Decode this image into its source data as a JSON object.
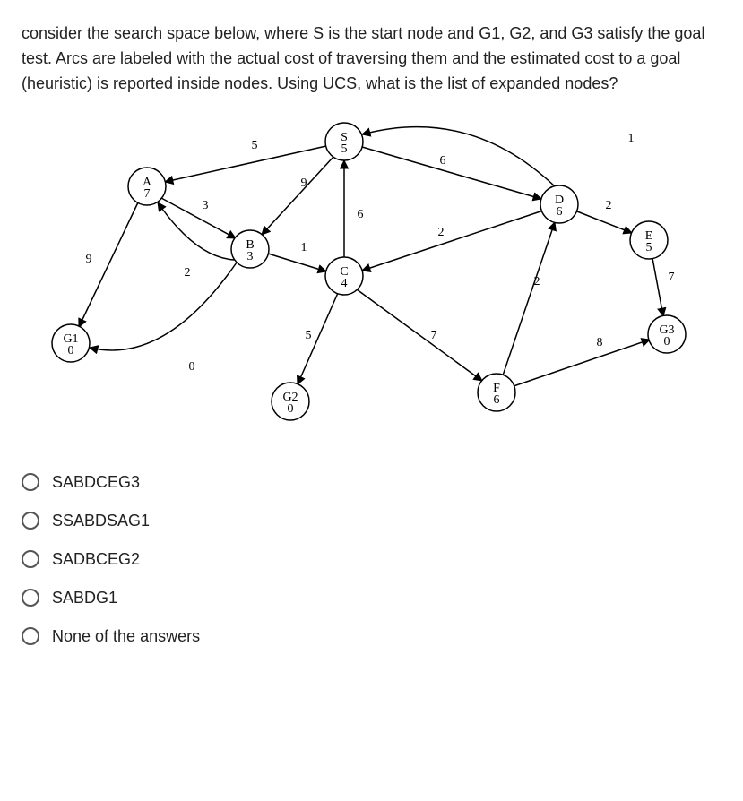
{
  "question": "consider the search space below, where S is the start node and G1, G2, and G3 satisfy the goal test. Arcs are labeled with the actual cost of traversing them and the estimated cost to a goal (heuristic) is reported inside nodes. Using UCS, what is the list of expanded nodes?",
  "nodes": {
    "S": {
      "label": "S",
      "h": "5"
    },
    "A": {
      "label": "A",
      "h": "7"
    },
    "B": {
      "label": "B",
      "h": "3"
    },
    "C": {
      "label": "C",
      "h": "4"
    },
    "D": {
      "label": "D",
      "h": "6"
    },
    "E": {
      "label": "E",
      "h": "5"
    },
    "F": {
      "label": "F",
      "h": "6"
    },
    "G1": {
      "label": "G1",
      "h": "0"
    },
    "G2": {
      "label": "G2",
      "h": "0"
    },
    "G3": {
      "label": "G3",
      "h": "0"
    }
  },
  "edges": {
    "SA": "5",
    "SB": "9",
    "SD": "6",
    "AB": "3",
    "AG1": "9",
    "BA": "2",
    "BC": "1",
    "BG1": "0",
    "DC": "2",
    "DE": "2",
    "DS": "1",
    "CS": "6",
    "CG2": "5",
    "CF": "7",
    "FD": "2",
    "FG3": "8",
    "EG3": "7"
  },
  "options": [
    "SABDCEG3",
    "SSABDSAG1",
    "SADBCEG2",
    "SABDG1",
    "None of the answers"
  ]
}
